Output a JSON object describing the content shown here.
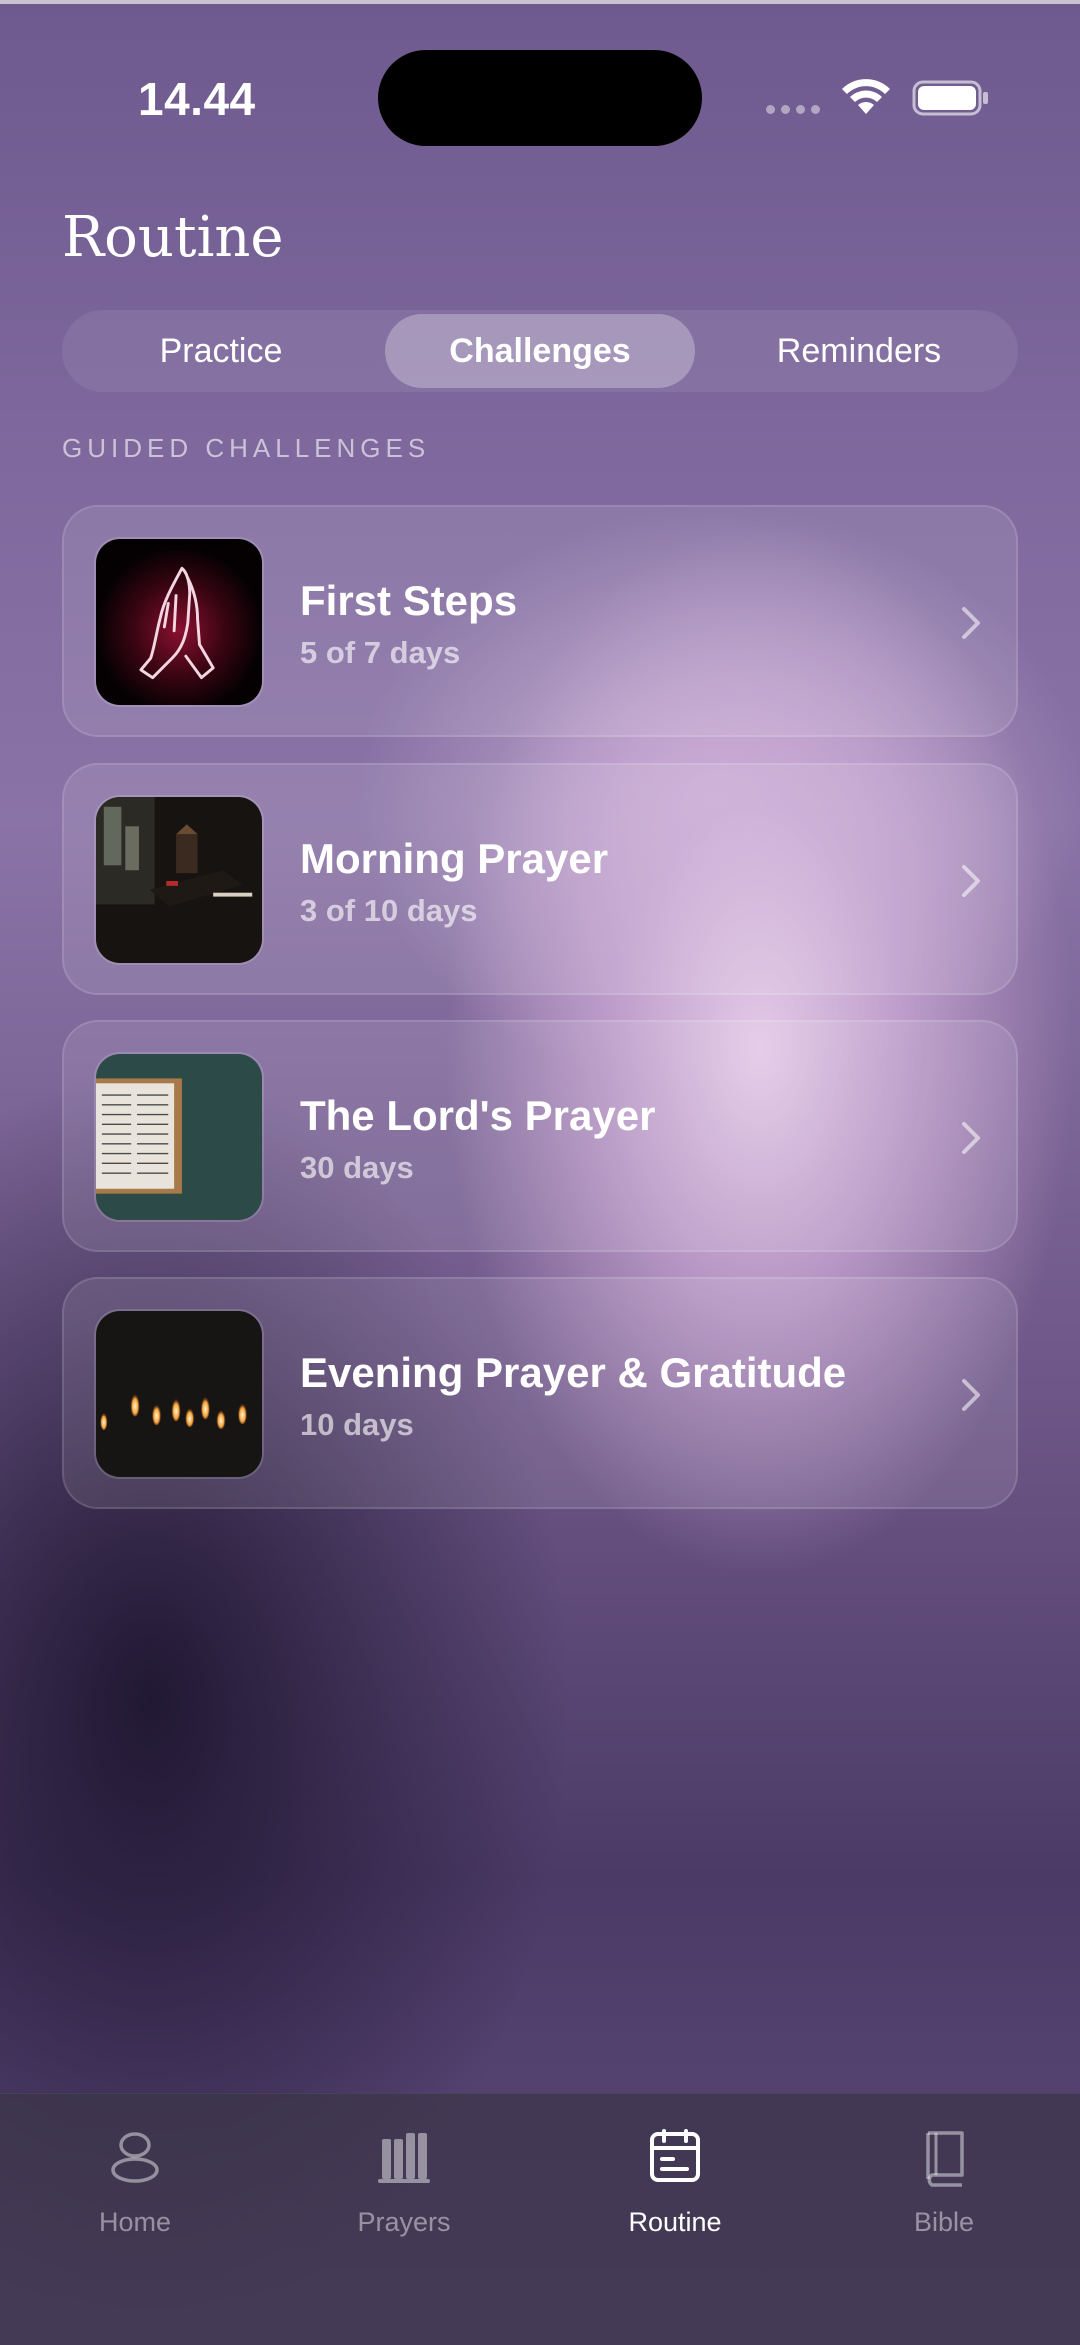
{
  "status_bar": {
    "time": "14.44"
  },
  "header": {
    "title": "Routine"
  },
  "segments": [
    {
      "label": "Practice",
      "active": false
    },
    {
      "label": "Challenges",
      "active": true
    },
    {
      "label": "Reminders",
      "active": false
    }
  ],
  "section": {
    "label": "GUIDED CHALLENGES"
  },
  "challenges": [
    {
      "title": "First Steps",
      "subtitle": "5 of 7 days",
      "image": "praying-hands-neon"
    },
    {
      "title": "Morning Prayer",
      "subtitle": "3 of 10 days",
      "image": "bible-on-table"
    },
    {
      "title": "The Lord's Prayer",
      "subtitle": "30 days",
      "image": "open-bible-green"
    },
    {
      "title": "Evening Prayer & Gratitude",
      "subtitle": "10 days",
      "image": "candles"
    }
  ],
  "tabbar": {
    "items": [
      {
        "label": "Home",
        "icon": "home-icon",
        "active": false
      },
      {
        "label": "Prayers",
        "icon": "prayers-icon",
        "active": false
      },
      {
        "label": "Routine",
        "icon": "routine-icon",
        "active": true
      },
      {
        "label": "Bible",
        "icon": "bible-icon",
        "active": false
      }
    ]
  }
}
